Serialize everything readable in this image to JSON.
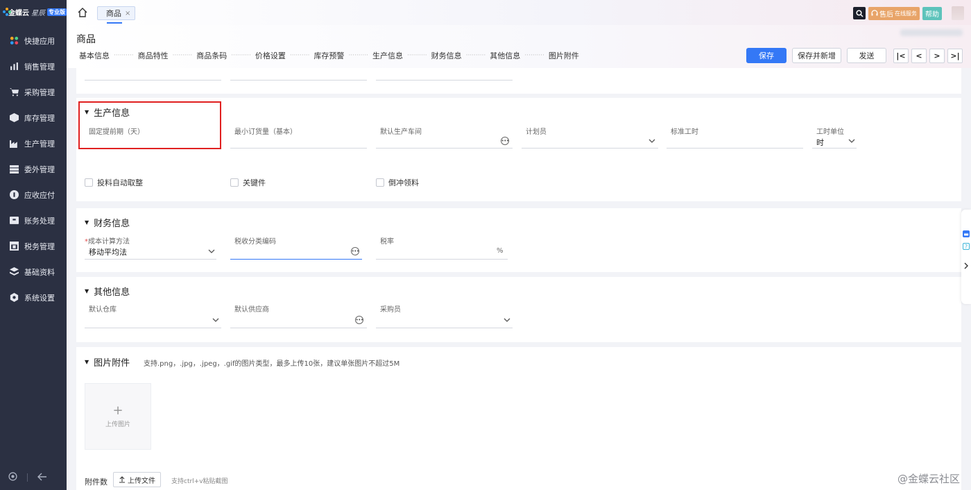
{
  "app": {
    "logo_text": "金蝶云",
    "logo_star": "星辰",
    "logo_version": "专业版"
  },
  "sidebar": {
    "items": [
      {
        "label": "快捷应用",
        "icon": "apps-icon"
      },
      {
        "label": "销售管理",
        "icon": "sales-icon"
      },
      {
        "label": "采购管理",
        "icon": "cart-icon"
      },
      {
        "label": "库存管理",
        "icon": "box-icon"
      },
      {
        "label": "生产管理",
        "icon": "factory-icon"
      },
      {
        "label": "委外管理",
        "icon": "outsource-icon"
      },
      {
        "label": "应收应付",
        "icon": "money-icon"
      },
      {
        "label": "账务处理",
        "icon": "ledger-icon"
      },
      {
        "label": "税务管理",
        "icon": "tax-icon"
      },
      {
        "label": "基础资料",
        "icon": "layers-icon"
      },
      {
        "label": "系统设置",
        "icon": "settings-icon"
      }
    ]
  },
  "topbar": {
    "tab_label": "商品",
    "tab_close": "×",
    "service_label": "售后",
    "service_sub": "在线服务",
    "help_label": "帮助"
  },
  "header": {
    "title": "商品",
    "anchors": [
      "基本信息",
      "商品特性",
      "商品条码",
      "价格设置",
      "库存预警",
      "生产信息",
      "财务信息",
      "其他信息",
      "图片附件"
    ],
    "anchor_sep": "··········",
    "save_label": "保存",
    "save_new_label": "保存并新增",
    "send_label": "发送",
    "pager": [
      "|<",
      "<",
      ">",
      ">|"
    ]
  },
  "production": {
    "title": "生产信息",
    "fields": {
      "lead_time": "固定提前期（天）",
      "min_order": "最小订货量（基本）",
      "default_workshop": "默认生产车间",
      "planner": "计划员",
      "std_hours": "标准工时",
      "hour_unit": "工时单位",
      "hour_unit_value": "时"
    },
    "checks": [
      "投料自动取整",
      "关键件",
      "倒冲领料"
    ]
  },
  "finance": {
    "title": "财务信息",
    "cost_method_label": "成本计算方法",
    "cost_method_required": "*",
    "cost_method_value": "移动平均法",
    "tax_code_label": "税收分类编码",
    "tax_rate_label": "税率",
    "tax_rate_unit": "%"
  },
  "other": {
    "title": "其他信息",
    "warehouse_label": "默认仓库",
    "supplier_label": "默认供应商",
    "buyer_label": "采购员"
  },
  "images": {
    "title": "图片附件",
    "hint": "支持.png，.jpg，.jpeg，.gif的图片类型，最多上传10张，建议单张图片不超过5M",
    "upload_image_label": "上传图片",
    "attachments_label": "附件数",
    "upload_file_label": "上传文件",
    "paste_hint": "支持ctrl+v粘贴截图"
  },
  "watermark": "@金蝶云社区",
  "colors": {
    "sidebar_bg": "#2b3042",
    "primary": "#3478f6",
    "highlight": "#e02020",
    "service": "#e8a468",
    "help": "#5dc3bb"
  }
}
